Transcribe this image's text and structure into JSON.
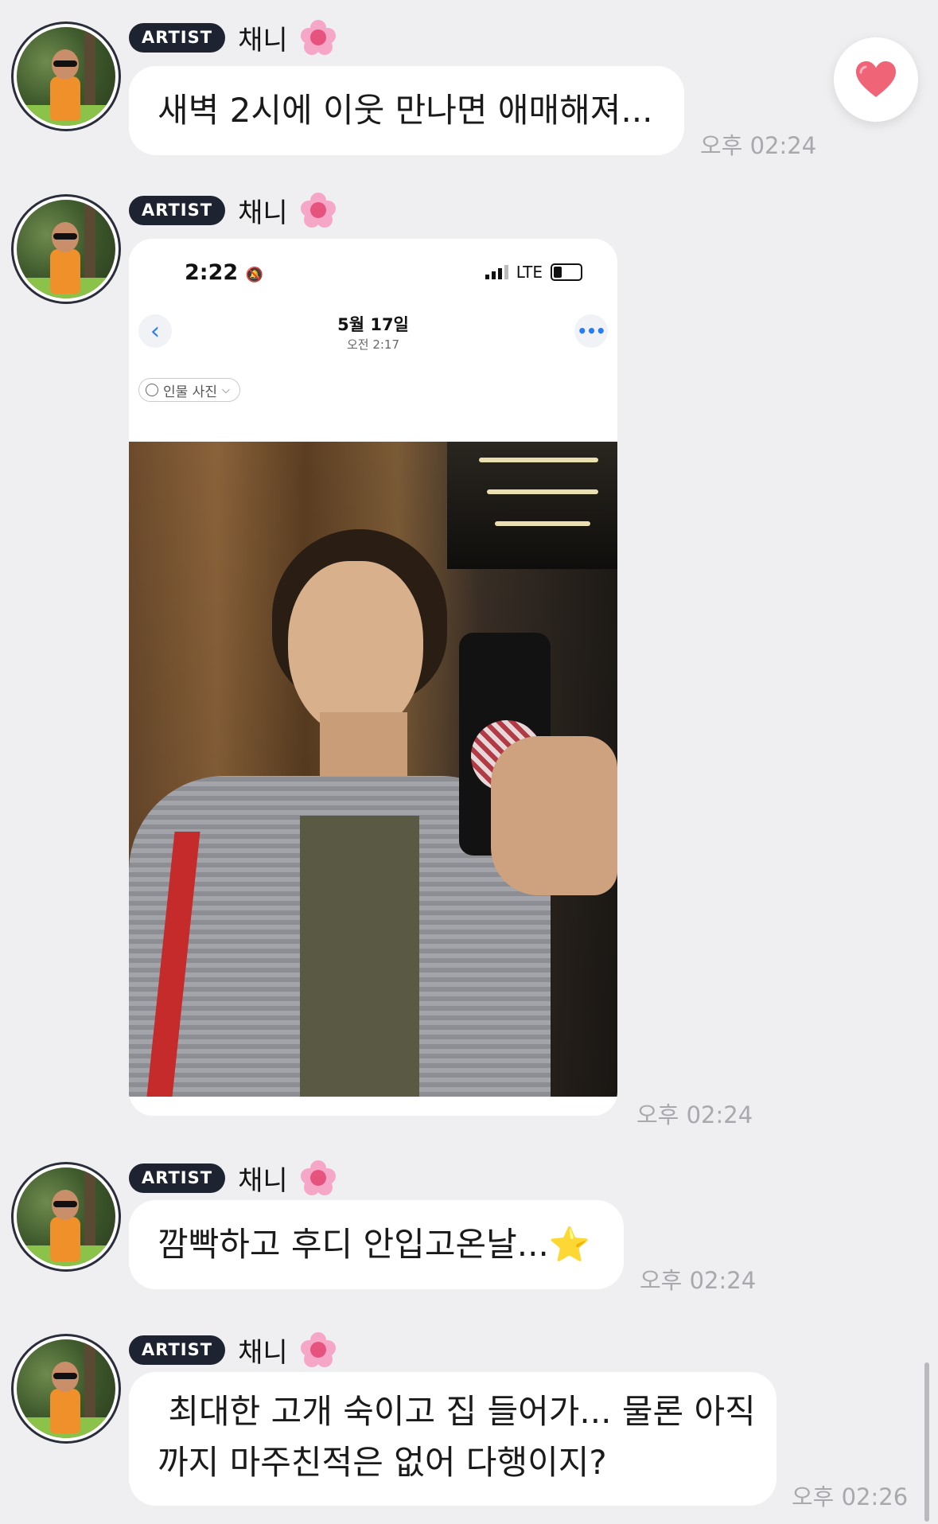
{
  "colors": {
    "background": "#efeff1",
    "badge": "#1d2330",
    "heart": "#f06478",
    "time": "#a8a9ad"
  },
  "messages": [
    {
      "badge": "ARTIST",
      "name": "채니",
      "emoji_icon": "cherry-blossom-icon",
      "text": "새벽 2시에 이웃 만나면 애매해져...",
      "time": "오후 02:24"
    },
    {
      "badge": "ARTIST",
      "name": "채니",
      "emoji_icon": "cherry-blossom-icon",
      "type": "image",
      "time": "오후 02:24",
      "screenshot": {
        "status_time": "2:22",
        "network": "LTE",
        "date_title": "5월 17일",
        "date_sub": "오전 2:17",
        "chip_label": "인물 사진"
      }
    },
    {
      "badge": "ARTIST",
      "name": "채니",
      "emoji_icon": "cherry-blossom-icon",
      "text": "깜빡하고 후디 안입고온날...⭐️",
      "time": "오후 02:24"
    },
    {
      "badge": "ARTIST",
      "name": "채니",
      "emoji_icon": "cherry-blossom-icon",
      "text_line1": " 최대한 고개 숙이고 집 들어가... 물론 아직",
      "text_line2": "까지 마주친적은 없어 다행이지?",
      "time": "오후 02:26"
    }
  ],
  "reaction": {
    "icon": "heart-icon"
  }
}
